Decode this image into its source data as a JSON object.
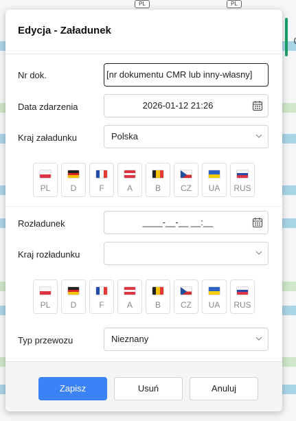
{
  "background": {
    "tags": [
      "PL",
      "PL"
    ],
    "right_value": "0"
  },
  "dialog": {
    "title": "Edycja - Załadunek",
    "doc_number": {
      "label": "Nr dok.",
      "value": "[nr dokumentu CMR lub inny-własny]"
    },
    "event_date": {
      "label": "Data zdarzenia",
      "value": "2026-01-12 21:26"
    },
    "loading_country": {
      "label": "Kraj załadunku",
      "value": "Polska"
    },
    "flags_loading": [
      "PL",
      "D",
      "F",
      "A",
      "B",
      "CZ",
      "UA",
      "RUS"
    ],
    "unloading": {
      "label": "Rozładunek",
      "value": "____-__-__ __:__"
    },
    "unloading_country": {
      "label": "Kraj rozładunku",
      "value": ""
    },
    "flags_unloading": [
      "PL",
      "D",
      "F",
      "A",
      "B",
      "CZ",
      "UA",
      "RUS"
    ],
    "transport_type": {
      "label": "Typ przewozu",
      "value": "Nieznany"
    },
    "buttons": {
      "save": "Zapisz",
      "delete": "Usuń",
      "cancel": "Anuluj"
    }
  },
  "colors": {
    "primary": "#3b82f6",
    "background_teal": "#a9d4e6",
    "green": "#19a06a"
  }
}
